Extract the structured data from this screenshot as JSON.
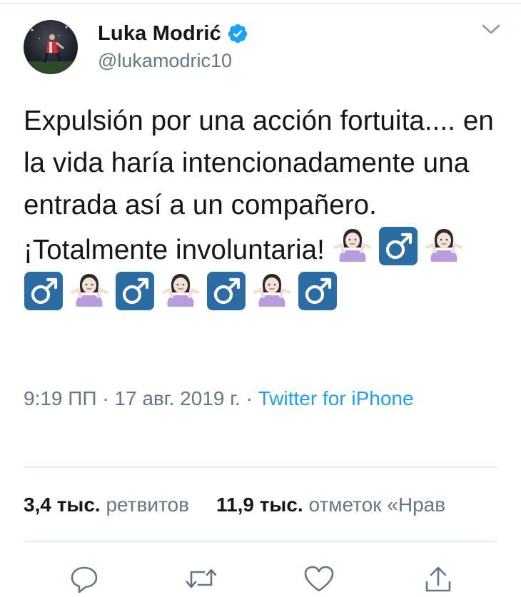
{
  "user": {
    "display_name": "Luka Modrić",
    "handle": "@lukamodric10",
    "verified": true
  },
  "tweet": {
    "text": "Expulsión por una acción fortuita.... en la vida haría intencionadamente una entrada así a un compañero. ¡Totalmente involuntaria!",
    "emojis": [
      "person-shrugging",
      "male-sign",
      "person-shrugging",
      "male-sign",
      "person-shrugging",
      "male-sign",
      "person-shrugging",
      "male-sign",
      "person-shrugging",
      "male-sign"
    ]
  },
  "meta": {
    "time": "9:19 ПП",
    "date": "17 авг. 2019 г.",
    "separator": "·",
    "source": "Twitter for iPhone"
  },
  "stats": {
    "retweets_count": "3,4 тыс.",
    "retweets_label": "ретвитов",
    "likes_count": "11,9 тыс.",
    "likes_label": "отметок «Нрав"
  },
  "actions": [
    "reply-icon",
    "retweet-icon",
    "like-icon",
    "share-icon"
  ],
  "colors": {
    "text": "#14171a",
    "secondary": "#657786",
    "link": "#1da1f2",
    "divider": "#e6ecf0",
    "verified": "#1da1f2"
  }
}
